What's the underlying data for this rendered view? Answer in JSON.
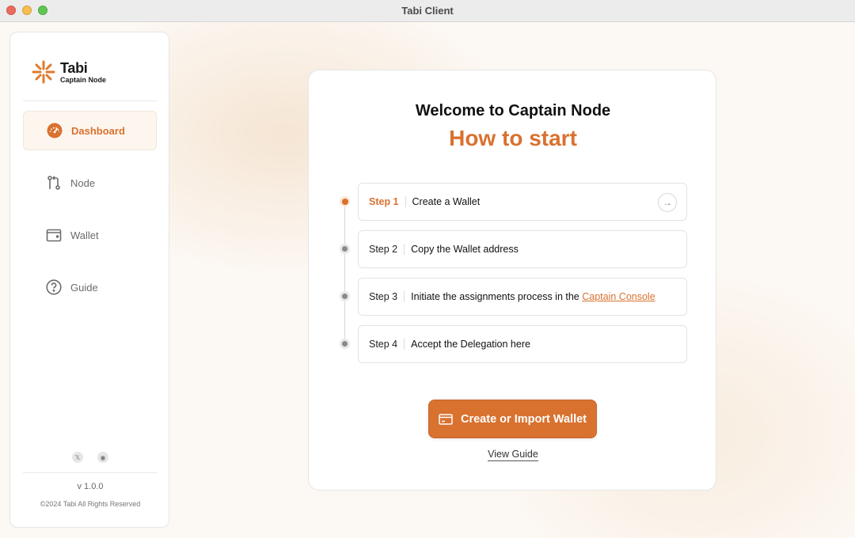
{
  "window": {
    "title": "Tabi Client"
  },
  "sidebar": {
    "logo": {
      "name": "Tabi",
      "subtitle": "Captain Node"
    },
    "items": [
      {
        "label": "Dashboard",
        "icon": "dashboard-gauge-icon",
        "active": true
      },
      {
        "label": "Node",
        "icon": "node-git-icon",
        "active": false
      },
      {
        "label": "Wallet",
        "icon": "wallet-icon",
        "active": false
      },
      {
        "label": "Guide",
        "icon": "question-circle-icon",
        "active": false
      }
    ],
    "social": [
      {
        "icon": "x-twitter-icon",
        "glyph": "𝕏"
      },
      {
        "icon": "discord-icon",
        "glyph": "◉"
      }
    ],
    "version": "v 1.0.0",
    "copyright": "©2024 Tabi All Rights Reserved"
  },
  "main": {
    "welcome": "Welcome to Captain Node",
    "heading": "How to start",
    "steps": [
      {
        "num": "Step 1",
        "text": "Create a Wallet",
        "active": true
      },
      {
        "num": "Step 2",
        "text": "Copy the Wallet address",
        "active": false
      },
      {
        "num": "Step 3",
        "text": "Initiate the assignments process in the ",
        "link": "Captain Console",
        "active": false
      },
      {
        "num": "Step 4",
        "text": "Accept the Delegation here",
        "active": false
      }
    ],
    "cta_label": "Create or Import Wallet",
    "view_guide": "View Guide"
  },
  "colors": {
    "accent": "#d9712f",
    "inactive_dot": "#8a8a8a"
  }
}
